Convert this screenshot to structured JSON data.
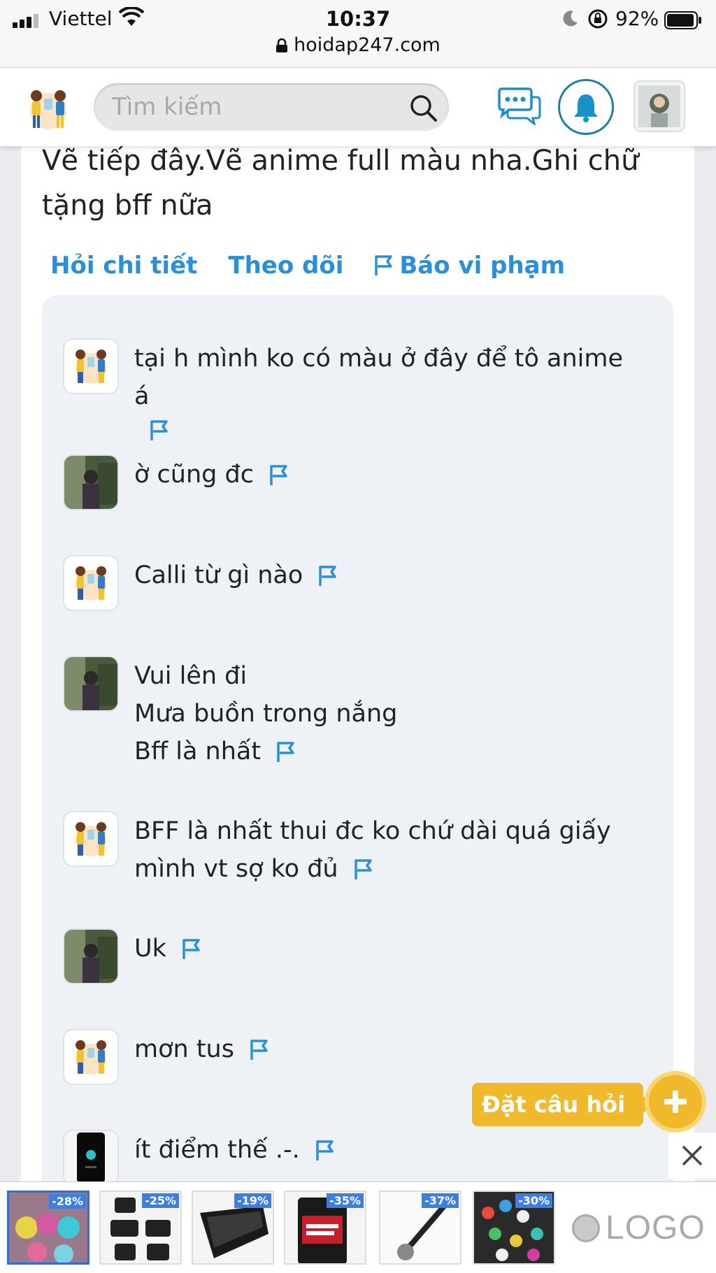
{
  "status_bar": {
    "carrier": "Viettel",
    "time": "10:37",
    "battery": "92%"
  },
  "browser": {
    "url": "hoidap247.com"
  },
  "header": {
    "search_placeholder": "Tìm kiếm"
  },
  "question": {
    "text": "Vẽ tiếp đây.Vẽ anime full màu nha.Ghi chữ tặng bff nữa",
    "actions": {
      "ask_detail": "Hỏi chi tiết",
      "follow": "Theo dõi",
      "report": "Báo vi phạm"
    }
  },
  "comments": [
    {
      "avatar": "illustration",
      "text": "tại h mình ko có màu ở đây để tô anime á"
    },
    {
      "avatar": "photo",
      "text": "ờ cũng đc"
    },
    {
      "avatar": "illustration",
      "text": "Calli từ gì nào"
    },
    {
      "avatar": "photo",
      "text": "Vui lên đi\nMưa buồn trong nắng\nBff là nhất"
    },
    {
      "avatar": "illustration",
      "text": "BFF là nhất thui đc ko chứ dài quá giấy mình vt sợ ko đủ"
    },
    {
      "avatar": "photo",
      "text": "Uk"
    },
    {
      "avatar": "illustration",
      "text": "mơn tus"
    },
    {
      "avatar": "dark-phone",
      "text": "ít điểm thế .-."
    }
  ],
  "ask_button": {
    "label": "Đặt câu hỏi"
  },
  "ad": {
    "items": [
      {
        "discount": "-28%"
      },
      {
        "discount": "-25%"
      },
      {
        "discount": "-19%"
      },
      {
        "discount": "-35%"
      },
      {
        "discount": "-37%"
      },
      {
        "discount": "-30%"
      }
    ],
    "logo_text": "LOGO"
  },
  "colors": {
    "accent_blue": "#2b8fd8",
    "ask_yellow": "#f0b92b",
    "bell_teal": "#1a7fa0"
  }
}
